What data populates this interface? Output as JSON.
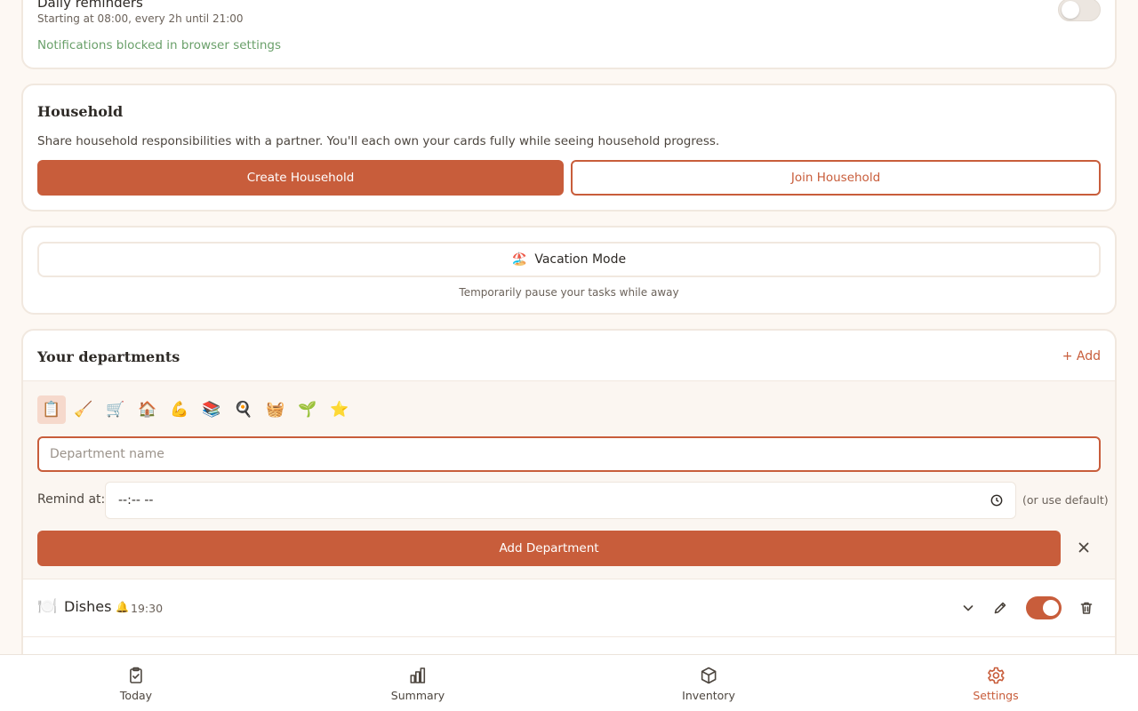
{
  "reminders": {
    "title": "Daily reminders",
    "subtitle": "Starting at 08:00, every 2h until 21:00",
    "warning": "Notifications blocked in browser settings",
    "enabled": false
  },
  "household": {
    "title": "Household",
    "description": "Share household responsibilities with a partner. You'll each own your cards fully while seeing household progress.",
    "create_label": "Create Household",
    "join_label": "Join Household"
  },
  "vacation": {
    "icon": "🏖️",
    "label": "Vacation Mode",
    "hint": "Temporarily pause your tasks while away"
  },
  "departments": {
    "title": "Your departments",
    "add_link": "+ Add",
    "emoji_options": [
      "📋",
      "🧹",
      "🛒",
      "🏠",
      "💪",
      "📚",
      "🍳",
      "🧺",
      "🌱",
      "⭐"
    ],
    "selected_emoji_index": 0,
    "name_placeholder": "Department name",
    "remind_label": "Remind at:",
    "time_value": "--:-- --",
    "default_hint": "(or use default)",
    "add_button": "Add Department",
    "items": [
      {
        "emoji": "🍽️",
        "name": "Dishes",
        "bell": "🔔",
        "time": "19:30",
        "enabled": true
      }
    ]
  },
  "nav": {
    "items": [
      {
        "label": "Today",
        "icon": "clipboard-check-icon",
        "active": false
      },
      {
        "label": "Summary",
        "icon": "bar-chart-icon",
        "active": false
      },
      {
        "label": "Inventory",
        "icon": "box-icon",
        "active": false
      },
      {
        "label": "Settings",
        "icon": "gear-icon",
        "active": true
      }
    ]
  },
  "colors": {
    "accent": "#c85d3b",
    "background": "#fdf8f3",
    "success_text": "#6aa06a"
  }
}
